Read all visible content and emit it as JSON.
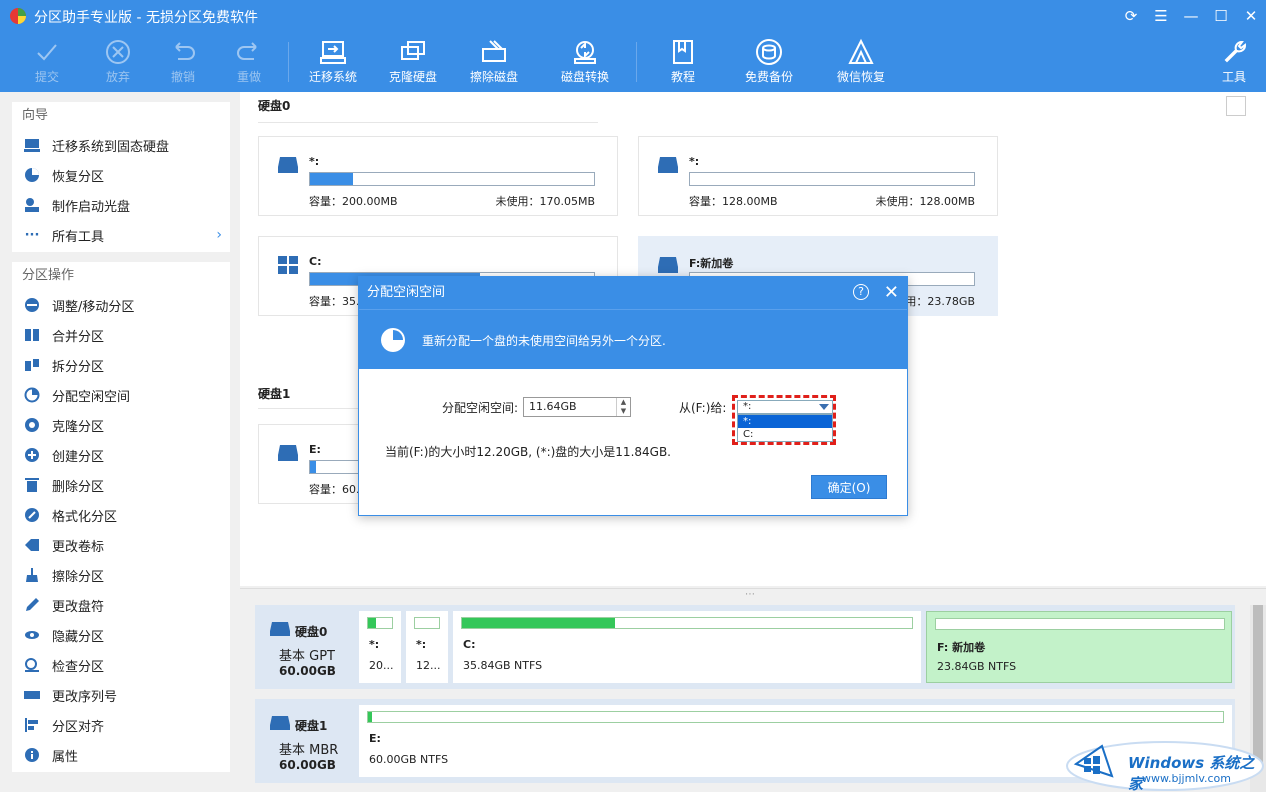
{
  "window": {
    "title": "分区助手专业版 - 无损分区免费软件",
    "controls": [
      "refresh-icon",
      "menu-icon",
      "minimize-icon",
      "maximize-icon",
      "close-icon"
    ]
  },
  "toolbar": {
    "commit": "提交",
    "discard": "放弃",
    "undo": "撤销",
    "redo": "重做",
    "migrate": "迁移系统",
    "clone": "克隆硬盘",
    "wipe": "擦除磁盘",
    "convert": "磁盘转换",
    "tutorial": "教程",
    "backup": "免费备份",
    "wechat": "微信恢复",
    "tools": "工具"
  },
  "sidebar": {
    "wizard_title": "向导",
    "wizard_items": [
      {
        "label": "迁移系统到固态硬盘",
        "icon": "migrate-ssd-icon"
      },
      {
        "label": "恢复分区",
        "icon": "recover-icon"
      },
      {
        "label": "制作启动光盘",
        "icon": "bootdisk-icon"
      },
      {
        "label": "所有工具",
        "icon": "dots-icon"
      }
    ],
    "ops_title": "分区操作",
    "ops_items": [
      {
        "label": "调整/移动分区",
        "icon": "resize-icon"
      },
      {
        "label": "合并分区",
        "icon": "merge-icon"
      },
      {
        "label": "拆分分区",
        "icon": "split-icon"
      },
      {
        "label": "分配空闲空间",
        "icon": "allocate-icon"
      },
      {
        "label": "克隆分区",
        "icon": "clone-icon"
      },
      {
        "label": "创建分区",
        "icon": "create-icon"
      },
      {
        "label": "删除分区",
        "icon": "delete-icon"
      },
      {
        "label": "格式化分区",
        "icon": "format-icon"
      },
      {
        "label": "更改卷标",
        "icon": "label-icon"
      },
      {
        "label": "擦除分区",
        "icon": "wipe-icon"
      },
      {
        "label": "更改盘符",
        "icon": "letter-icon"
      },
      {
        "label": "隐藏分区",
        "icon": "hide-icon"
      },
      {
        "label": "检查分区",
        "icon": "check-icon"
      },
      {
        "label": "更改序列号",
        "icon": "serial-icon"
      },
      {
        "label": "分区对齐",
        "icon": "align-icon"
      },
      {
        "label": "属性",
        "icon": "info-icon"
      }
    ]
  },
  "main": {
    "disk0_label": "硬盘0",
    "disk1_label": "硬盘1",
    "cards": [
      {
        "name": "*:",
        "capacity": "容量：200.00MB",
        "free": "未使用：170.05MB",
        "usage": 0.15
      },
      {
        "name": "*:",
        "capacity": "容量：128.00MB",
        "free": "未使用：128.00MB",
        "usage": 0.0
      },
      {
        "name": "C:",
        "capacity": "容量：35.",
        "free": "",
        "usage": 0.6
      },
      {
        "name": "F:新加卷",
        "capacity": "",
        "free": "未使用：23.78GB",
        "usage": 0.0
      },
      {
        "name": "E:",
        "capacity": "容量：60.",
        "free": "",
        "usage": 0.02
      }
    ]
  },
  "diskmap": {
    "disk0": {
      "name": "硬盘0",
      "type": "基本 GPT",
      "size": "60.00GB"
    },
    "disk1": {
      "name": "硬盘1",
      "type": "基本 MBR",
      "size": "60.00GB"
    },
    "d0_parts": [
      {
        "label": "*:",
        "info": "20...",
        "usage": 0.35
      },
      {
        "label": "*:",
        "info": "12...",
        "usage": 0.0
      },
      {
        "label": "C:",
        "info": "35.84GB NTFS",
        "usage": 0.34
      },
      {
        "label": "F: 新加卷",
        "info": "23.84GB NTFS",
        "usage": 0.0
      }
    ],
    "d1_parts": [
      {
        "label": "E:",
        "info": "60.00GB NTFS",
        "usage": 0.005
      }
    ]
  },
  "dialog": {
    "title": "分配空闲空间",
    "banner": "重新分配一个盘的未使用空间给另外一个分区.",
    "alloc_label": "分配空闲空间:",
    "alloc_value": "11.64GB",
    "from_label": "从(F:)给:",
    "select_value": "*:",
    "options": [
      "*:",
      "C:"
    ],
    "info": "当前(F:)的大小时12.20GB, (*:)盘的大小是11.84GB.",
    "ok": "确定(O)"
  },
  "watermark": {
    "line1": "Windows 系统之家",
    "line2": "www.bjjmlv.com"
  },
  "colors": {
    "accent": "#3a8ee6",
    "used_green": "#34c759",
    "selection_red": "#e0201a"
  }
}
